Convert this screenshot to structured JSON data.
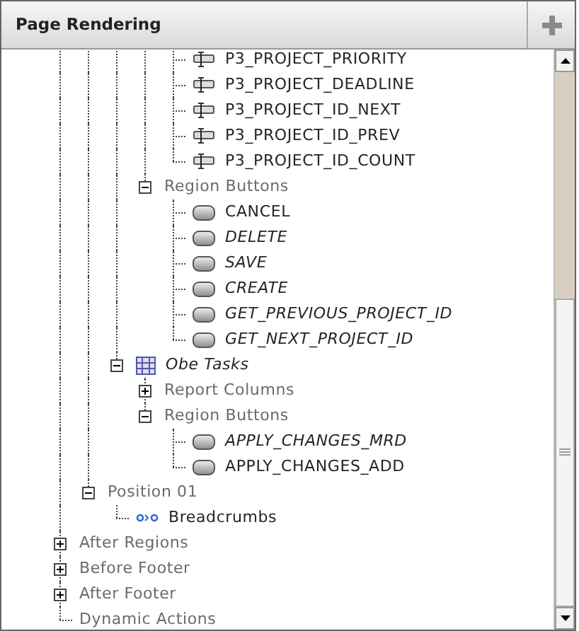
{
  "panel": {
    "title": "Page Rendering"
  },
  "tree": [
    {
      "children": [
        {
          "children": [
            {
              "children": [
                {
                  "children": [
                    {
                      "label": "P3_PROJECT_PRIORITY",
                      "kind": "item"
                    },
                    {
                      "label": "P3_PROJECT_DEADLINE",
                      "kind": "item"
                    },
                    {
                      "label": "P3_PROJECT_ID_NEXT",
                      "kind": "item"
                    },
                    {
                      "label": "P3_PROJECT_ID_PREV",
                      "kind": "item"
                    },
                    {
                      "label": "P3_PROJECT_ID_COUNT",
                      "kind": "item"
                    }
                  ]
                },
                {
                  "label": "Region Buttons",
                  "kind": "group",
                  "expanded": true,
                  "children": [
                    {
                      "label": "CANCEL",
                      "kind": "button",
                      "italic": false
                    },
                    {
                      "label": "DELETE",
                      "kind": "button",
                      "italic": true
                    },
                    {
                      "label": "SAVE",
                      "kind": "button",
                      "italic": true
                    },
                    {
                      "label": "CREATE",
                      "kind": "button",
                      "italic": true
                    },
                    {
                      "label": "GET_PREVIOUS_PROJECT_ID",
                      "kind": "button",
                      "italic": true
                    },
                    {
                      "label": "GET_NEXT_PROJECT_ID",
                      "kind": "button",
                      "italic": true
                    }
                  ]
                }
              ]
            },
            {
              "label": "Obe Tasks",
              "kind": "report",
              "italic": true,
              "expanded": true,
              "children": [
                {
                  "label": "Report Columns",
                  "kind": "group",
                  "expanded": false
                },
                {
                  "label": "Region Buttons",
                  "kind": "group",
                  "expanded": true,
                  "children": [
                    {
                      "label": "APPLY_CHANGES_MRD",
                      "kind": "button",
                      "italic": true
                    },
                    {
                      "label": "APPLY_CHANGES_ADD",
                      "kind": "button",
                      "italic": false
                    }
                  ]
                }
              ]
            }
          ]
        },
        {
          "label": "Position 01",
          "kind": "group",
          "expanded": true,
          "children": [
            {
              "label": "Breadcrumbs",
              "kind": "breadcrumb"
            }
          ]
        }
      ]
    },
    {
      "label": "After Regions",
      "kind": "group",
      "expanded": false
    },
    {
      "label": "Before Footer",
      "kind": "group",
      "expanded": false
    },
    {
      "label": "After Footer",
      "kind": "group",
      "expanded": false
    },
    {
      "label": "Dynamic Actions",
      "kind": "group"
    }
  ]
}
